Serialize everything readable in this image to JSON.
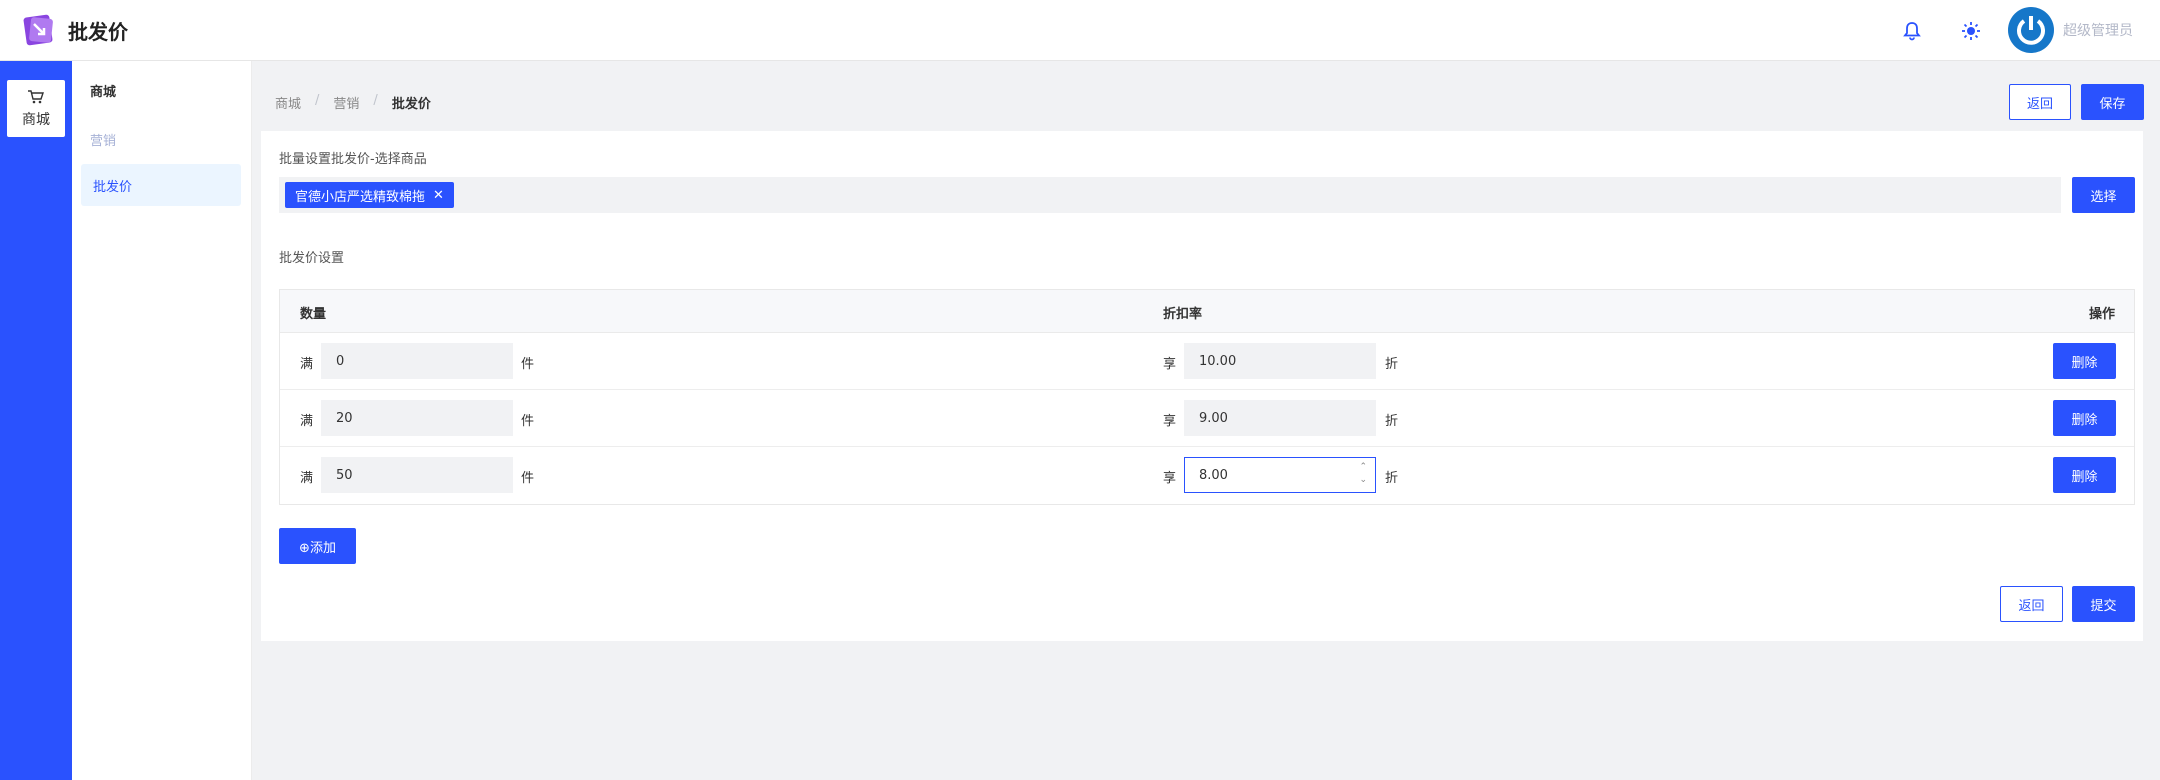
{
  "header": {
    "title": "批发价",
    "username": "超级管理员"
  },
  "sidebar_main": {
    "items": [
      {
        "label": "商城",
        "icon": "cart-icon"
      }
    ]
  },
  "sidebar_sub": {
    "title": "商城",
    "group": "营销",
    "items": [
      {
        "label": "批发价"
      }
    ]
  },
  "breadcrumb": [
    "商城",
    "营销",
    "批发价"
  ],
  "top_actions": {
    "back": "返回",
    "save": "保存"
  },
  "goods": {
    "label": "批量设置批发价-选择商品",
    "selected": [
      "官德小店严选精致棉拖"
    ],
    "choose_button": "选择"
  },
  "price_settings": {
    "label": "批发价设置",
    "columns": [
      "数量",
      "折扣率",
      "操作"
    ],
    "prefix_qty": "满",
    "suffix_qty": "件",
    "prefix_rate": "享",
    "suffix_rate": "折",
    "delete_label": "删除",
    "rows": [
      {
        "qty": "0",
        "rate": "10.00"
      },
      {
        "qty": "20",
        "rate": "9.00"
      },
      {
        "qty": "50",
        "rate": "8.00"
      }
    ],
    "add_label": "⊕添加"
  },
  "bottom_actions": {
    "back": "返回",
    "submit": "提交"
  },
  "colors": {
    "primary": "#2a52fe",
    "sidebar_active_bg": "#ebf5ff",
    "page_bg": "#f1f2f4"
  }
}
